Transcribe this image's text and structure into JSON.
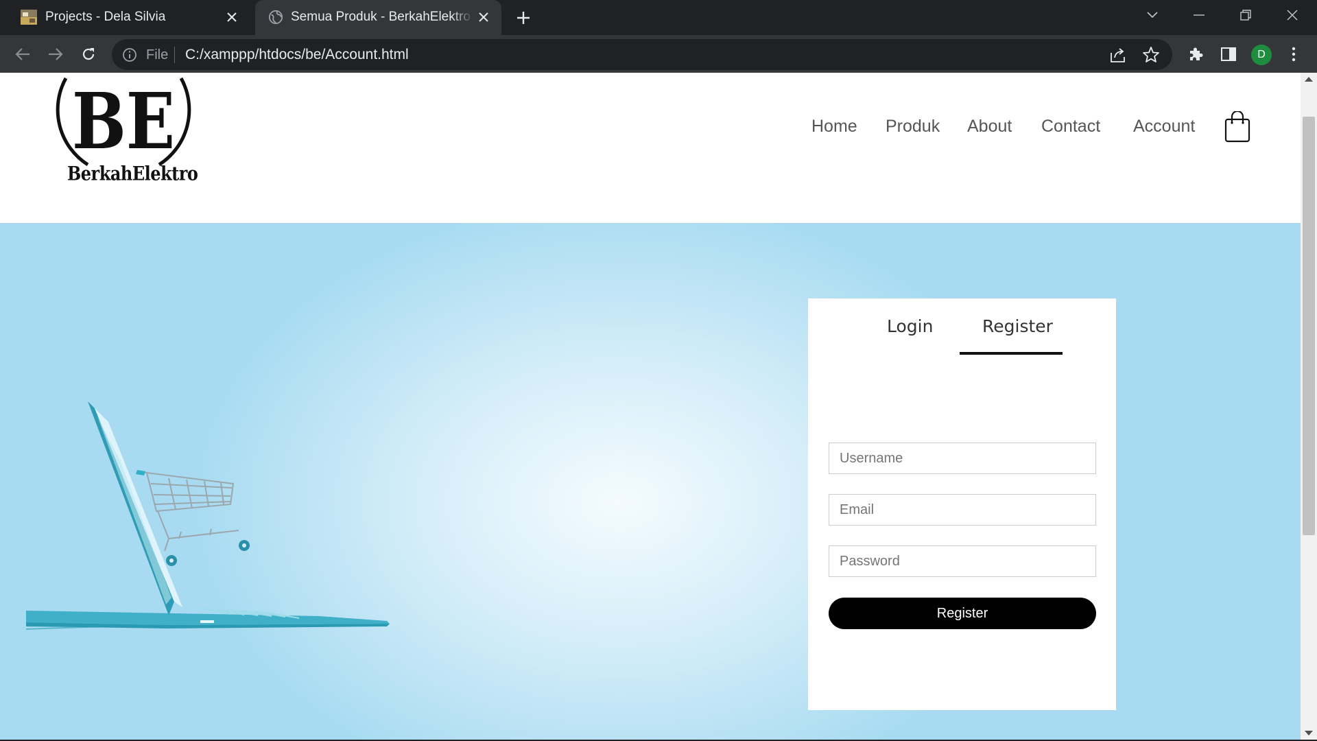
{
  "browser": {
    "tabs": [
      {
        "title": "Projects - Dela Silvia",
        "active": false
      },
      {
        "title": "Semua Produk - BerkahElektro | E",
        "active": true
      }
    ],
    "omnibox": {
      "scheme_label": "File",
      "url": "C:/xamppp/htdocs/be/Account.html"
    },
    "profile_initial": "D"
  },
  "site": {
    "logo": {
      "mark": "BE",
      "name": "BerkahElektro"
    },
    "nav": [
      "Home",
      "Produk",
      "About",
      "Contact",
      "Account"
    ],
    "form": {
      "tabs": [
        "Login",
        "Register"
      ],
      "active_tab": "Register",
      "fields": {
        "username_placeholder": "Username",
        "email_placeholder": "Email",
        "password_placeholder": "Password"
      },
      "submit_label": "Register"
    }
  },
  "colors": {
    "browser_bg": "#202124",
    "toolbar_bg": "#35363a",
    "hero_center": "#f4fbfe",
    "hero_edge": "#a8dbf1",
    "button": "#000000"
  }
}
